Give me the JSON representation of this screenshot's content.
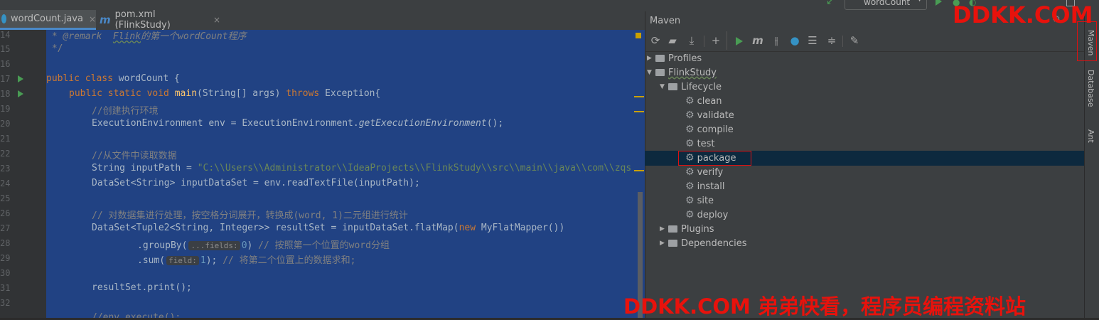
{
  "tabs": [
    {
      "label": "wordCount.java",
      "close": "×",
      "icon": "java-class-icon"
    },
    {
      "label": "pom.xml (FlinkStudy)",
      "close": "×",
      "icon": "maven-m-icon",
      "icon_text": "m"
    }
  ],
  "run_config": "wordCount",
  "editor": {
    "line_numbers": [
      "14",
      "15",
      "16",
      "17",
      "18",
      "19",
      "20",
      "21",
      "22",
      "23",
      "24",
      "25",
      "26",
      "27",
      "28",
      "29",
      "30",
      "31",
      "32"
    ],
    "lines": {
      "l14a": " * @remark  ",
      "l14b": "Flink",
      "l14c": "的第一个wordCount程序",
      "l15": " */",
      "l17_kw": "public class ",
      "l17_rest": "wordCount {",
      "l18_kw": "public static void ",
      "l18_fn": "main",
      "l18_mid": "(String[] args) ",
      "l18_kw2": "throws ",
      "l18_rest": "Exception{",
      "l19": "//创建执行环境",
      "l20a": "ExecutionEnvironment env = ExecutionEnvironment.",
      "l20b": "getExecutionEnvironment",
      "l20c": "();",
      "l22": "//从文件中读取数据",
      "l23a": "String inputPath = ",
      "l23b": "\"C:\\\\Users\\\\Administrator\\\\IdeaProjects\\\\FlinkStudy\\\\src\\\\main\\\\java\\\\com\\\\zqs",
      "l24": "DataSet<String> inputDataSet = env.readTextFile(inputPath);",
      "l26": "// 对数据集进行处理，按空格分词展开，转换成(word, 1)二元组进行统计",
      "l27a": "DataSet<Tuple2<String, Integer>> resultSet = inputDataSet.flatMap(",
      "l27_kw": "new ",
      "l27b": "MyFlatMapper())",
      "l28a": ".groupBy(",
      "l28_hint": "...fields:",
      "l28_num": "0",
      "l28b": ") ",
      "l28_cm": "// 按照第一个位置的word分组",
      "l29a": ".sum(",
      "l29_hint": "field:",
      "l29_num": "1",
      "l29b": "); ",
      "l29_cm": "// 将第二个位置上的数据求和;",
      "l31": "resultSet.print();",
      "l32": "//env.execute();"
    }
  },
  "maven": {
    "title": "Maven",
    "toolbar_icons": [
      "reload-icon",
      "add-maven-project-icon",
      "download-icon",
      "plus-icon",
      "run-icon",
      "execute-goal-icon",
      "toggle-offline-icon",
      "skip-tests-icon",
      "show-dependencies-icon",
      "collapse-all-icon",
      "settings-wrench-icon"
    ],
    "tree": {
      "profiles": "Profiles",
      "project": "FlinkStudy",
      "lifecycle": "Lifecycle",
      "goals": [
        "clean",
        "validate",
        "compile",
        "test",
        "package",
        "verify",
        "install",
        "site",
        "deploy"
      ],
      "plugins": "Plugins",
      "dependencies": "Dependencies"
    },
    "selected_goal": "package"
  },
  "side_tabs": [
    "Maven",
    "Database",
    "Ant"
  ],
  "watermarks": {
    "top": "DDKK.COM",
    "bottom": "DDKK.COM 弟弟快看，程序员编程资料站"
  },
  "colors": {
    "selection": "#214283",
    "highlight_box": "#dd1111",
    "watermark": "#e8120c"
  }
}
